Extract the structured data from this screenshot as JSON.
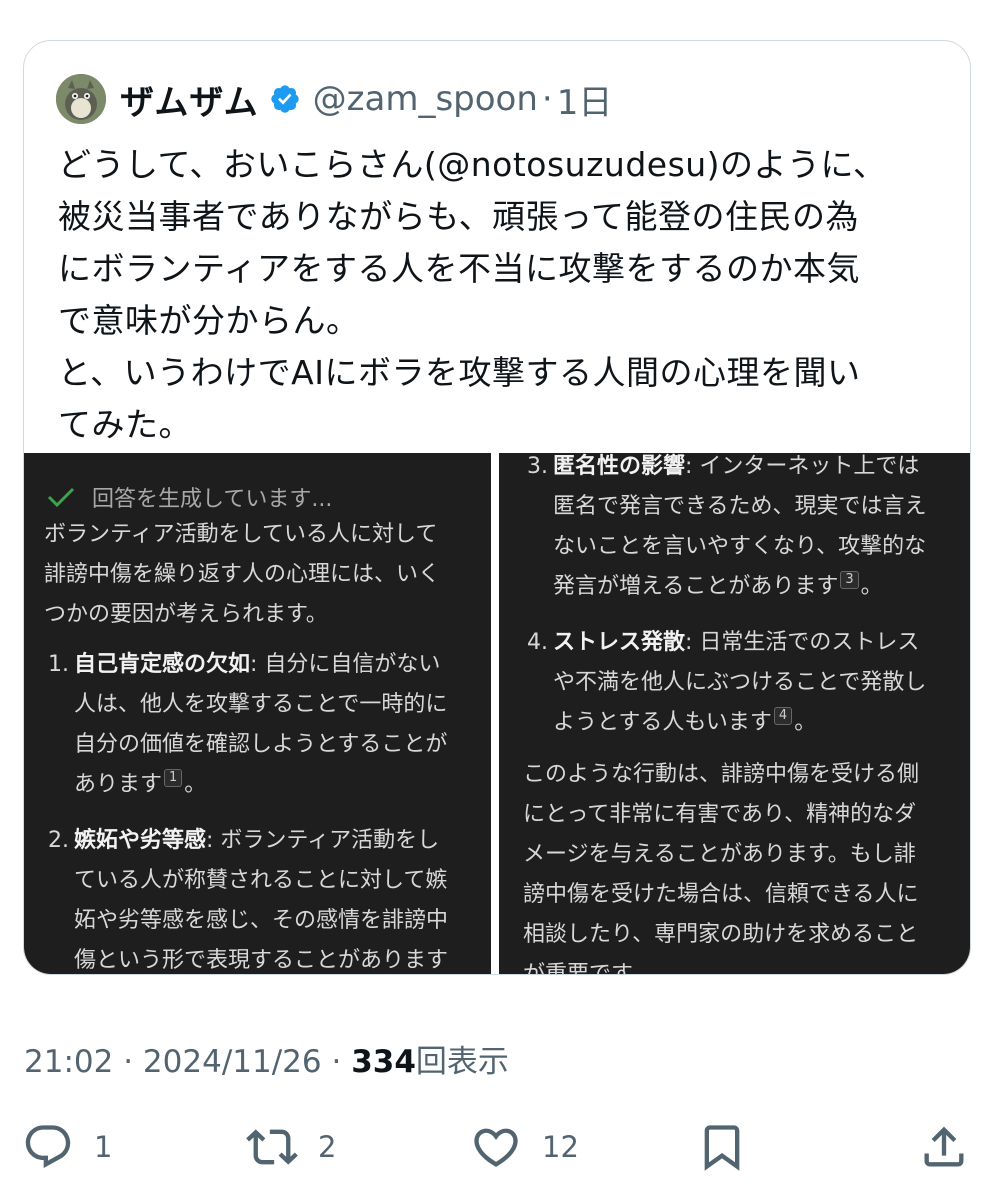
{
  "quote": {
    "author_name": "ザムザム",
    "author_handle": "@zam_spoon",
    "separator": "·",
    "time_ago": "1日",
    "text": "どうして、おいこらさん(@notosuzudesu)のように、\n被災当事者でありながらも、頑張って能登の住民の為\nにボランティアをする人を不当に攻撃をするのか本気\nで意味が分からん。\nと、いうわけでAIにボラを攻撃する人間の心理を聞い\nてみた。",
    "verified_color": "#1d9bf0"
  },
  "media": {
    "left": {
      "status": "回答を生成しています...",
      "intro": "ボランティア活動をしている人に対して\n誹謗中傷を繰り返す人の心理には、いく\nつかの要因が考えられます。",
      "items": [
        {
          "num": "1.",
          "title": "自己肯定感の欠如",
          "text": ": 自分に自信がない\n人は、他人を攻撃することで一時的に\n自分の価値を確認しようとすることが\nあります",
          "cite": "1",
          "end": "。"
        },
        {
          "num": "2.",
          "title": "嫉妬や劣等感",
          "text": ": ボランティア活動をし\nている人が称賛されることに対して嫉\n妬や劣等感を感じ、その感情を誹謗中\n傷という形で表現することがあります"
        }
      ]
    },
    "right": {
      "items": [
        {
          "num": "3.",
          "title": "匿名性の影響",
          "text": ": インターネット上では\n匿名で発言できるため、現実では言え\nないことを言いやすくなり、攻撃的な\n発言が増えることがあります",
          "cite": "3",
          "end": "。"
        },
        {
          "num": "4.",
          "title": "ストレス発散",
          "text": ": 日常生活でのストレス\nや不満を他人にぶつけることで発散し\nようとする人もいます",
          "cite": "4",
          "end": "。"
        }
      ],
      "outro": "このような行動は、誹謗中傷を受ける側\nにとって非常に有害であり、精神的なダ\nメージを与えることがあります。もし誹\n謗中傷を受けた場合は、信頼できる人に\n相談したり、専門家の助けを求めること\nが重要です。"
    }
  },
  "meta": {
    "time": "21:02",
    "date": "2024/11/26",
    "sep": "·",
    "views": "334",
    "views_label": "回表示"
  },
  "actions": {
    "replies": "1",
    "reposts": "2",
    "likes": "12"
  }
}
